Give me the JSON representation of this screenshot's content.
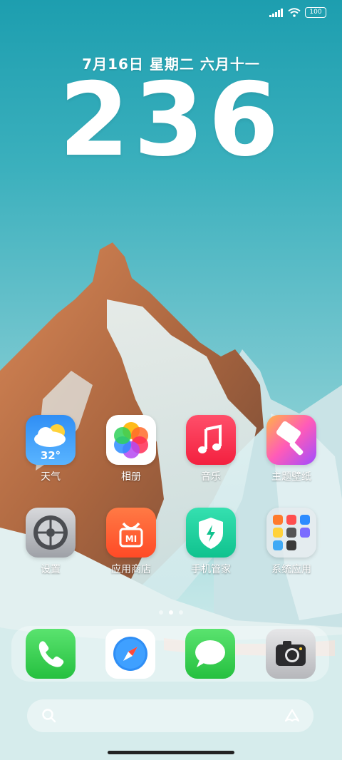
{
  "status_bar": {
    "battery": "100"
  },
  "lockscreen": {
    "date": "7月16日 星期二 六月十一",
    "time": "236"
  },
  "apps": [
    {
      "label": "天气",
      "icon": "weather-icon",
      "temp": "32°"
    },
    {
      "label": "相册",
      "icon": "photos-icon"
    },
    {
      "label": "音乐",
      "icon": "music-icon"
    },
    {
      "label": "主题壁纸",
      "icon": "themes-icon"
    },
    {
      "label": "设置",
      "icon": "settings-icon"
    },
    {
      "label": "应用商店",
      "icon": "app-store-icon"
    },
    {
      "label": "手机管家",
      "icon": "security-icon"
    },
    {
      "label": "系统应用",
      "icon": "folder-icon"
    }
  ],
  "dock": [
    {
      "icon": "phone-icon"
    },
    {
      "icon": "browser-icon"
    },
    {
      "icon": "messages-icon"
    },
    {
      "icon": "camera-icon"
    }
  ],
  "page_indicator": {
    "count": 3,
    "active": 1
  },
  "colors": {
    "sky": "#1d9eaf",
    "snow": "#e7f4f3",
    "accent_green": "#2fd159"
  }
}
